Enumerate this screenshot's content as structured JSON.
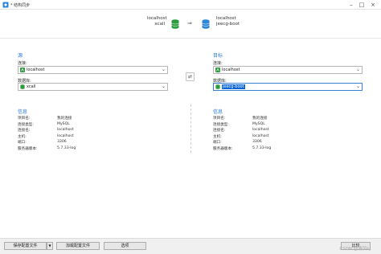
{
  "window": {
    "title": "* 结构同步"
  },
  "header": {
    "source": {
      "host": "localhost",
      "database": "xcall"
    },
    "target": {
      "host": "localhost",
      "database": "jeecg-boot"
    },
    "arrow": "⇒"
  },
  "source": {
    "section_title": "源",
    "connection_label": "连接:",
    "connection_value": "localhost",
    "database_label": "数据库:",
    "database_value": "xcall",
    "info_title": "信息",
    "info": [
      {
        "key": "项目名:",
        "value": "我的连接"
      },
      {
        "key": "连接类型:",
        "value": "MySQL"
      },
      {
        "key": "连接名:",
        "value": "localhost"
      },
      {
        "key": "主机:",
        "value": "localhost"
      },
      {
        "key": "端口:",
        "value": "3306"
      },
      {
        "key": "服务器版本:",
        "value": "5.7.33-log"
      }
    ]
  },
  "target": {
    "section_title": "目标",
    "connection_label": "连接:",
    "connection_value": "localhost",
    "database_label": "数据库:",
    "database_value": "jeecg-boot",
    "info_title": "信息",
    "info": [
      {
        "key": "项目名:",
        "value": "我的连接"
      },
      {
        "key": "连接类型:",
        "value": "MySQL"
      },
      {
        "key": "连接名:",
        "value": "localhost"
      },
      {
        "key": "主机:",
        "value": "localhost"
      },
      {
        "key": "端口:",
        "value": "3306"
      },
      {
        "key": "服务器版本:",
        "value": "5.7.33-log"
      }
    ]
  },
  "swap_icon": "⇄",
  "footer": {
    "save_profile": "保存配置文件",
    "load_profile": "加载配置文件",
    "options": "选项",
    "next": "比较",
    "watermark": "CSDN @清风kj"
  },
  "colors": {
    "accent": "#2c7ad6",
    "db_source": "#2e9b3e",
    "db_target": "#2d86d6",
    "selection": "#0a64d6"
  },
  "icons": [
    "app-icon",
    "database-icon",
    "mysql-connection-icon",
    "swap-icon",
    "chevron-down-icon",
    "minimize-icon",
    "maximize-icon",
    "close-icon"
  ]
}
